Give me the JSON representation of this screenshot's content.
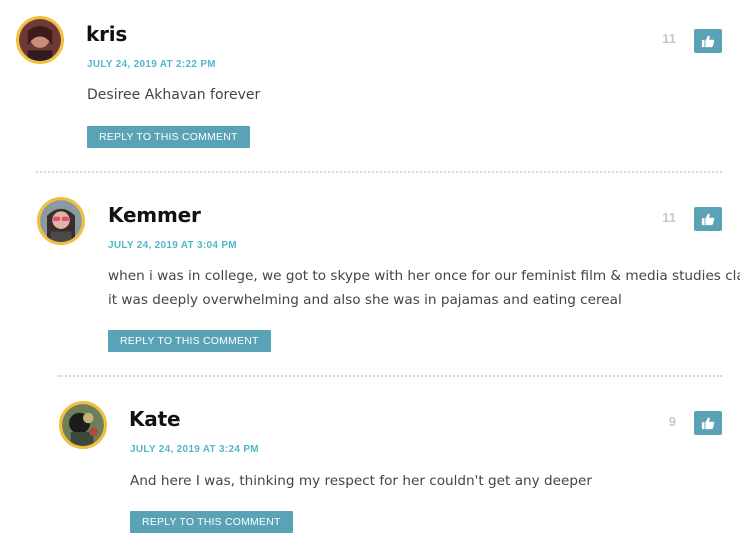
{
  "reply_label": "REPLY TO THIS COMMENT",
  "accent_color": "#5aa3b7",
  "date_color": "#52b8c8",
  "comments": [
    {
      "author": "kris",
      "date": "JULY 24, 2019 AT 2:22 PM",
      "text": "Desiree Akhavan forever",
      "likes": "11"
    },
    {
      "author": "Kemmer",
      "date": "JULY 24, 2019 AT 3:04 PM",
      "text_lines": [
        "when i was in college, we got to skype with her once for our feminist film & media studies class.",
        "it was deeply overwhelming and also she was in pajamas and eating cereal"
      ],
      "likes": "11"
    },
    {
      "author": "Kate",
      "date": "JULY 24, 2019 AT 3:24 PM",
      "text": "And here I was, thinking my respect for her couldn't get any deeper",
      "likes": "9"
    }
  ]
}
